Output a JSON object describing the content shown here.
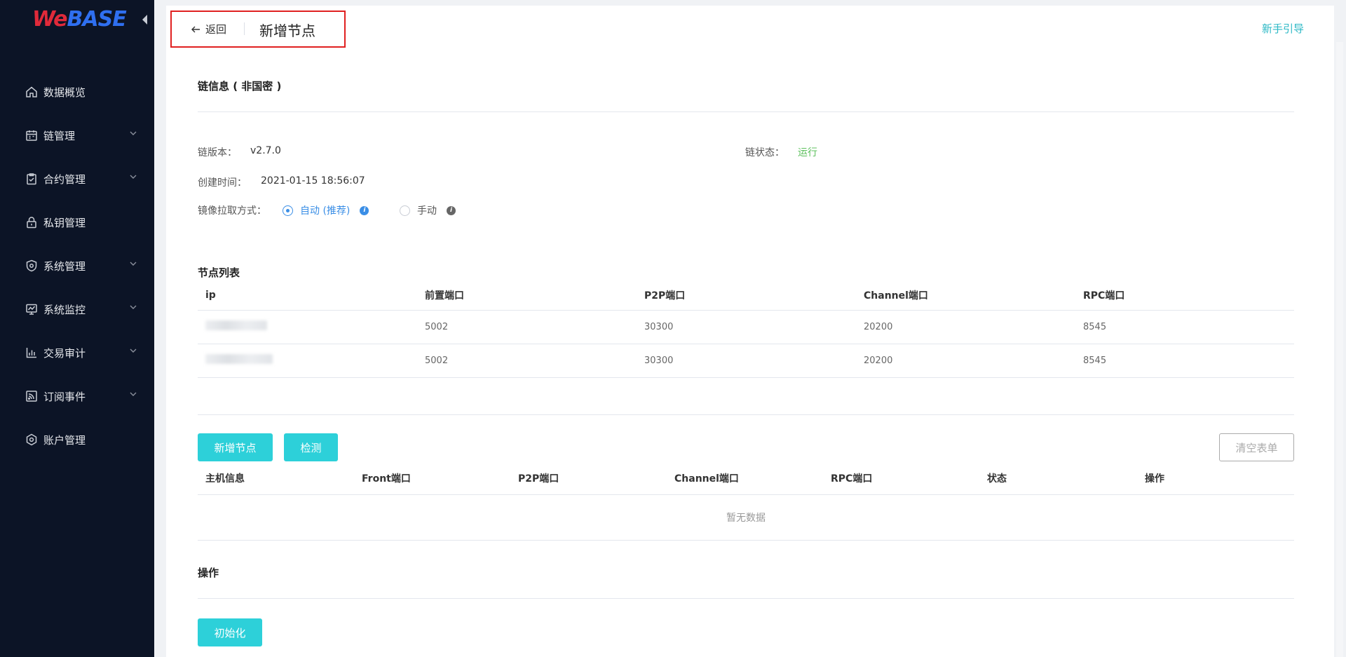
{
  "app": {
    "logo_we": "We",
    "logo_base": "BASE"
  },
  "sidebar": {
    "items": [
      {
        "label": "数据概览",
        "icon": "home-icon",
        "has_submenu": false
      },
      {
        "label": "链管理",
        "icon": "calendar-icon",
        "has_submenu": true
      },
      {
        "label": "合约管理",
        "icon": "clipboard-check-icon",
        "has_submenu": true
      },
      {
        "label": "私钥管理",
        "icon": "lock-icon",
        "has_submenu": false
      },
      {
        "label": "系统管理",
        "icon": "shield-icon",
        "has_submenu": true
      },
      {
        "label": "系统监控",
        "icon": "monitor-chart-icon",
        "has_submenu": true
      },
      {
        "label": "交易审计",
        "icon": "bar-chart-icon",
        "has_submenu": true
      },
      {
        "label": "订阅事件",
        "icon": "rss-icon",
        "has_submenu": true
      },
      {
        "label": "账户管理",
        "icon": "hexagon-gear-icon",
        "has_submenu": false
      }
    ]
  },
  "header": {
    "back_label": "返回",
    "title": "新增节点",
    "guide_link": "新手引导"
  },
  "chain_info": {
    "section_title": "链信息 ( 非国密 )",
    "version_label": "链版本：",
    "version_value": "v2.7.0",
    "status_label": "链状态：",
    "status_value": "运行",
    "created_label": "创建时间：",
    "created_value": "2021-01-15 18:56:07",
    "pull_label": "镜像拉取方式：",
    "pull_options": [
      {
        "label": "自动 (推荐)",
        "checked": true
      },
      {
        "label": "手动",
        "checked": false
      }
    ]
  },
  "node_list": {
    "section_title": "节点列表",
    "columns": [
      "ip",
      "前置端口",
      "P2P端口",
      "Channel端口",
      "RPC端口"
    ],
    "rows": [
      {
        "front": "5002",
        "p2p": "30300",
        "channel": "20200",
        "rpc": "8545"
      },
      {
        "front": "5002",
        "p2p": "30300",
        "channel": "20200",
        "rpc": "8545"
      }
    ]
  },
  "new_nodes": {
    "add_button": "新增节点",
    "check_button": "检测",
    "clear_button": "清空表单",
    "columns": [
      "主机信息",
      "Front端口",
      "P2P端口",
      "Channel端口",
      "RPC端口",
      "状态",
      "操作"
    ],
    "empty_text": "暂无数据"
  },
  "operations": {
    "section_title": "操作",
    "init_button": "初始化"
  },
  "colors": {
    "sidebar_bg": "#0c1426",
    "accent": "#2dd0d9",
    "link": "#2bb8c5",
    "running": "#5cc05c",
    "radio_active": "#3a8ee6"
  }
}
